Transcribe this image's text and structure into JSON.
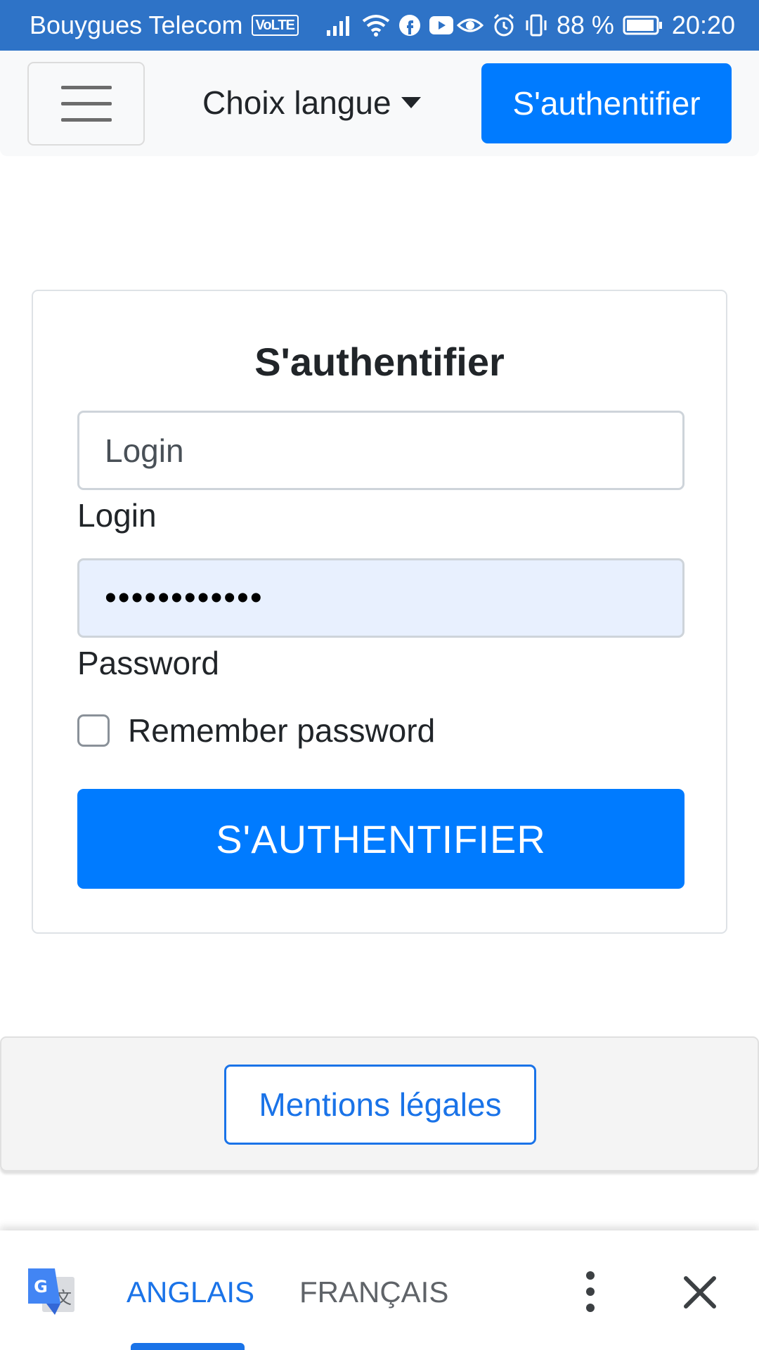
{
  "status_bar": {
    "carrier": "Bouygues Telecom",
    "volte": "VoLTE",
    "battery": "88 %",
    "time": "20:20",
    "icons": [
      "signal-icon",
      "wifi-icon",
      "facebook-icon",
      "youtube-icon",
      "eye-icon",
      "alarm-icon",
      "vibrate-icon",
      "battery-icon"
    ]
  },
  "navbar": {
    "language_dropdown": "Choix langue",
    "login_button": "S'authentifier"
  },
  "form": {
    "title": "S'authentifier",
    "login_placeholder": "Login",
    "login_label": "Login",
    "password_value": "••••••••••••",
    "password_label": "Password",
    "remember_label": "Remember password",
    "remember_checked": false,
    "submit_label": "S'AUTHENTIFIER"
  },
  "footer": {
    "legal_button": "Mentions légales"
  },
  "translate_bar": {
    "source_tab": "ANGLAIS",
    "target_tab": "FRANÇAIS",
    "active_tab": "ANGLAIS"
  },
  "colors": {
    "primary": "#007bff",
    "status_bar": "#2e73c7",
    "link_blue": "#1a73e8",
    "autofill": "#e8f0fe"
  }
}
